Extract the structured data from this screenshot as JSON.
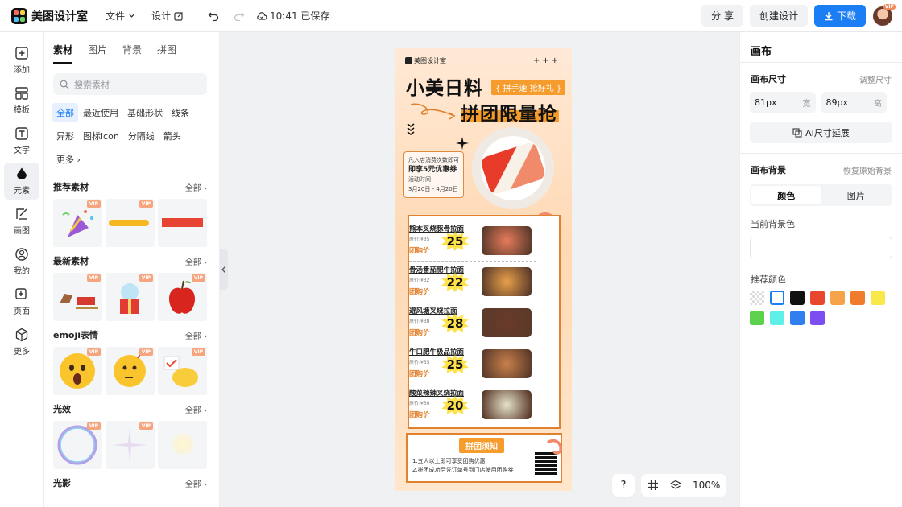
{
  "app": {
    "name": "美图设计室",
    "saved_time": "10:41 已保存"
  },
  "menu": {
    "file": "文件",
    "design": "设计"
  },
  "actions": {
    "share": "分 享",
    "create": "创建设计",
    "download": "下载",
    "vip": "VIP"
  },
  "rail": [
    {
      "label": "添加",
      "icon": "plus-square-icon"
    },
    {
      "label": "模板",
      "icon": "template-icon"
    },
    {
      "label": "文字",
      "icon": "text-icon"
    },
    {
      "label": "元素",
      "icon": "element-icon",
      "active": true
    },
    {
      "label": "画图",
      "icon": "draw-icon"
    },
    {
      "label": "我的",
      "icon": "user-icon"
    },
    {
      "label": "页面",
      "icon": "page-icon"
    },
    {
      "label": "更多",
      "icon": "cube-icon"
    }
  ],
  "panel": {
    "tabs": [
      "素材",
      "图片",
      "背景",
      "拼图"
    ],
    "search_placeholder": "搜索素材",
    "chips": [
      "全部",
      "最近使用",
      "基础形状",
      "线条",
      "异形",
      "图标icon",
      "分隔线",
      "箭头",
      "更多"
    ],
    "all_label": "全部",
    "vip_label": "VIP",
    "sections": [
      {
        "title": "推荐素材"
      },
      {
        "title": "最新素材"
      },
      {
        "title": "emoji表情"
      },
      {
        "title": "光效"
      },
      {
        "title": "光影"
      }
    ]
  },
  "poster": {
    "brand": "美图设计室",
    "stars": "+++",
    "title1": "小美日料",
    "tag": "{ 拼手速 抢好礼 }",
    "title2": "拼团限量抢",
    "coupon_line1": "凡入店消费次数即可",
    "coupon_line2": "即享5元优惠券",
    "coupon_line3": "活动时间",
    "coupon_line4": "3月20日 - 4月20日",
    "price_label": "团购价",
    "dishes": [
      {
        "name": "熊本叉烧豚骨拉面",
        "orig": "原价:¥35",
        "price": "25"
      },
      {
        "name": "骨汤番茄肥牛拉面",
        "orig": "原价:¥32",
        "price": "22"
      },
      {
        "name": "避风塘叉烧拉面",
        "orig": "原价:¥38",
        "price": "28"
      },
      {
        "name": "牛口肥牛极品拉面",
        "orig": "原价:¥35",
        "price": "25"
      },
      {
        "name": "酸菜辣辣叉烧拉面",
        "orig": "原价:¥30",
        "price": "20"
      }
    ],
    "notice_title": "拼团须知",
    "notice_line1": "1.五人以上即可享受团购优惠",
    "notice_line2": "2.拼团成功后凭订单号到门店使用团购券"
  },
  "canvas_controls": {
    "help": "?",
    "zoom": "100%"
  },
  "right": {
    "title": "画布",
    "size_label": "画布尺寸",
    "adjust_size": "调整尺寸",
    "width_value": "81px",
    "width_unit": "宽",
    "height_value": "89px",
    "height_unit": "高",
    "ai_button": "AI尺寸延展",
    "bg_label": "画布背景",
    "restore_bg": "恢复原始背景",
    "seg_color": "颜色",
    "seg_image": "图片",
    "current_bg": "当前背景色",
    "recommended": "推荐颜色",
    "swatches": [
      "transparent",
      "#ffffff",
      "#111111",
      "#e8472e",
      "#f5a348",
      "#ef7c2c",
      "#f8e84a",
      "#5bd14d",
      "#5ef0e8",
      "#2f7ff0",
      "#7c4df0"
    ]
  },
  "colors": {
    "accent": "#1c7ef5",
    "poster_orange": "#f59c2c"
  }
}
